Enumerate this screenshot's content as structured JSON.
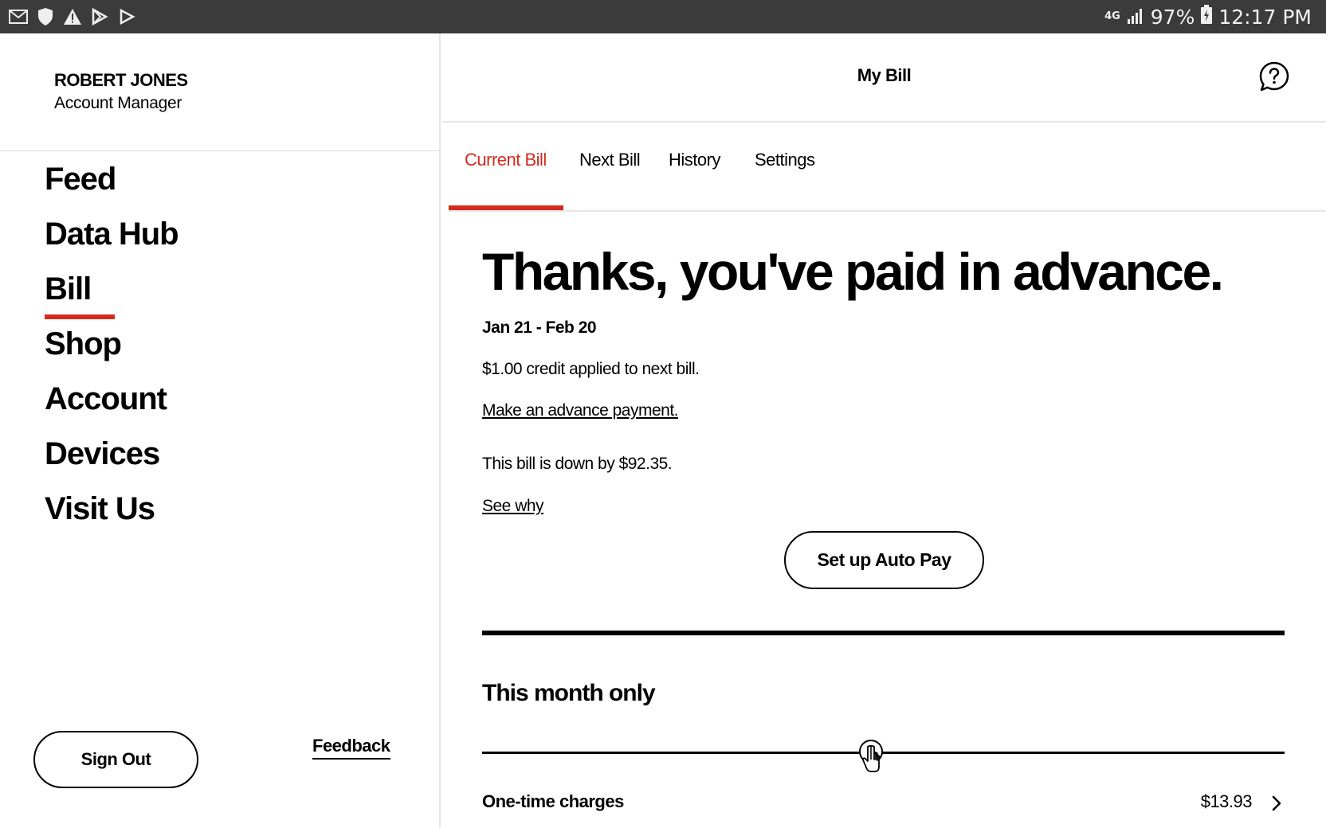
{
  "status_bar": {
    "network": "4G",
    "battery": "97%",
    "time": "12:17 PM",
    "left_icons": [
      "gmail-icon",
      "shield-icon",
      "warning-icon",
      "play-store-icon",
      "play-icon"
    ]
  },
  "sidebar": {
    "profile_name": "ROBERT JONES",
    "profile_role": "Account Manager",
    "nav_items": [
      {
        "label": "Feed"
      },
      {
        "label": "Data Hub"
      },
      {
        "label": "Bill"
      },
      {
        "label": "Shop"
      },
      {
        "label": "Account"
      },
      {
        "label": "Devices"
      },
      {
        "label": "Visit Us"
      }
    ],
    "active_index": 2,
    "sign_out_label": "Sign Out",
    "feedback_label": "Feedback"
  },
  "header": {
    "title": "My Bill"
  },
  "tabs": [
    {
      "label": "Current Bill"
    },
    {
      "label": "Next Bill"
    },
    {
      "label": "History"
    },
    {
      "label": "Settings"
    }
  ],
  "bill": {
    "headline": "Thanks, you've paid in advance.",
    "period": "Jan 21 - Feb 20",
    "credit_text": "$1.00 credit applied to next bill.",
    "advance_link": "Make an advance payment.",
    "down_text": "This bill is down by $92.35.",
    "see_why_link": "See why",
    "autopay_label": "Set up Auto Pay",
    "section_title": "This month only",
    "charges": [
      {
        "label": "One-time charges",
        "amount": "$13.93"
      }
    ]
  },
  "colors": {
    "accent_red": "#d52b1e",
    "status_bar_bg": "#3b3b3b"
  }
}
